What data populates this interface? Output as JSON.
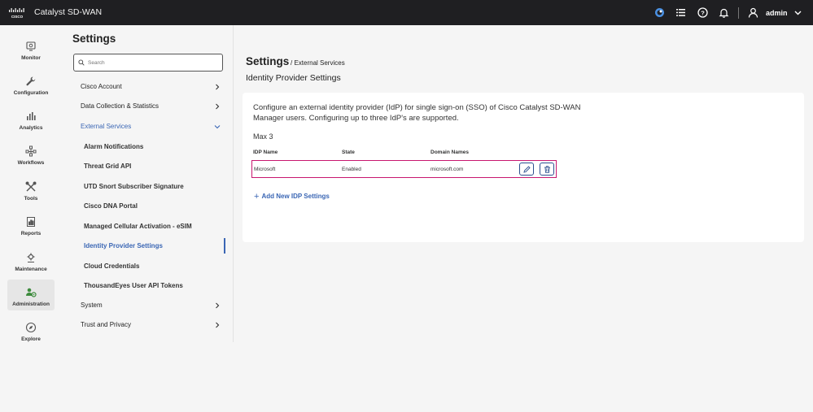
{
  "header": {
    "app_title": "Catalyst SD-WAN",
    "user": "admin",
    "icons": [
      "cisco-logo",
      "sync-status-icon",
      "task-list-icon",
      "help-icon",
      "notification-bell-icon",
      "user-icon",
      "chevron-down-icon"
    ]
  },
  "leftnav": {
    "items": [
      {
        "label": "Monitor",
        "icon": "monitor-icon"
      },
      {
        "label": "Configuration",
        "icon": "wrench-icon"
      },
      {
        "label": "Analytics",
        "icon": "bar-chart-icon"
      },
      {
        "label": "Workflows",
        "icon": "workflow-icon"
      },
      {
        "label": "Tools",
        "icon": "tools-icon"
      },
      {
        "label": "Reports",
        "icon": "report-icon"
      },
      {
        "label": "Maintenance",
        "icon": "maintenance-icon"
      },
      {
        "label": "Administration",
        "icon": "admin-users-icon"
      },
      {
        "label": "Explore",
        "icon": "compass-icon"
      }
    ],
    "active": "Administration"
  },
  "settings": {
    "title": "Settings",
    "search_placeholder": "Search",
    "menu": {
      "cisco_account": "Cisco Account",
      "data_collection": "Data Collection & Statistics",
      "external_services": "External Services",
      "system": "System",
      "trust_privacy": "Trust and Privacy"
    },
    "sub_items": [
      "Alarm Notifications",
      "Threat Grid API",
      "UTD Snort Subscriber Signature",
      "Cisco DNA Portal",
      "Managed Cellular Activation - eSIM",
      "Identity Provider Settings",
      "Cloud Credentials",
      "ThousandEyes User API Tokens"
    ],
    "active_sub": "Identity Provider Settings"
  },
  "main": {
    "breadcrumb_root": "Settings",
    "breadcrumb_current": "/ External Services",
    "heading": "Identity Provider Settings",
    "description": "Configure an external identity provider (IdP) for single sign-on (SSO) of Cisco Catalyst SD-WAN Manager users. Configuring up to three IdP's are supported.",
    "max_label": "Max 3",
    "table": {
      "headers": [
        "IDP Name",
        "State",
        "Domain Names"
      ],
      "rows": [
        {
          "name": "Microsoft",
          "state": "Enabled",
          "domain": "microsoft.com"
        }
      ]
    },
    "add_label": "Add New IDP Settings"
  },
  "colors": {
    "accent": "#3a66b4",
    "highlight_border": "#c8176f",
    "topbar": "#1f1f22"
  }
}
